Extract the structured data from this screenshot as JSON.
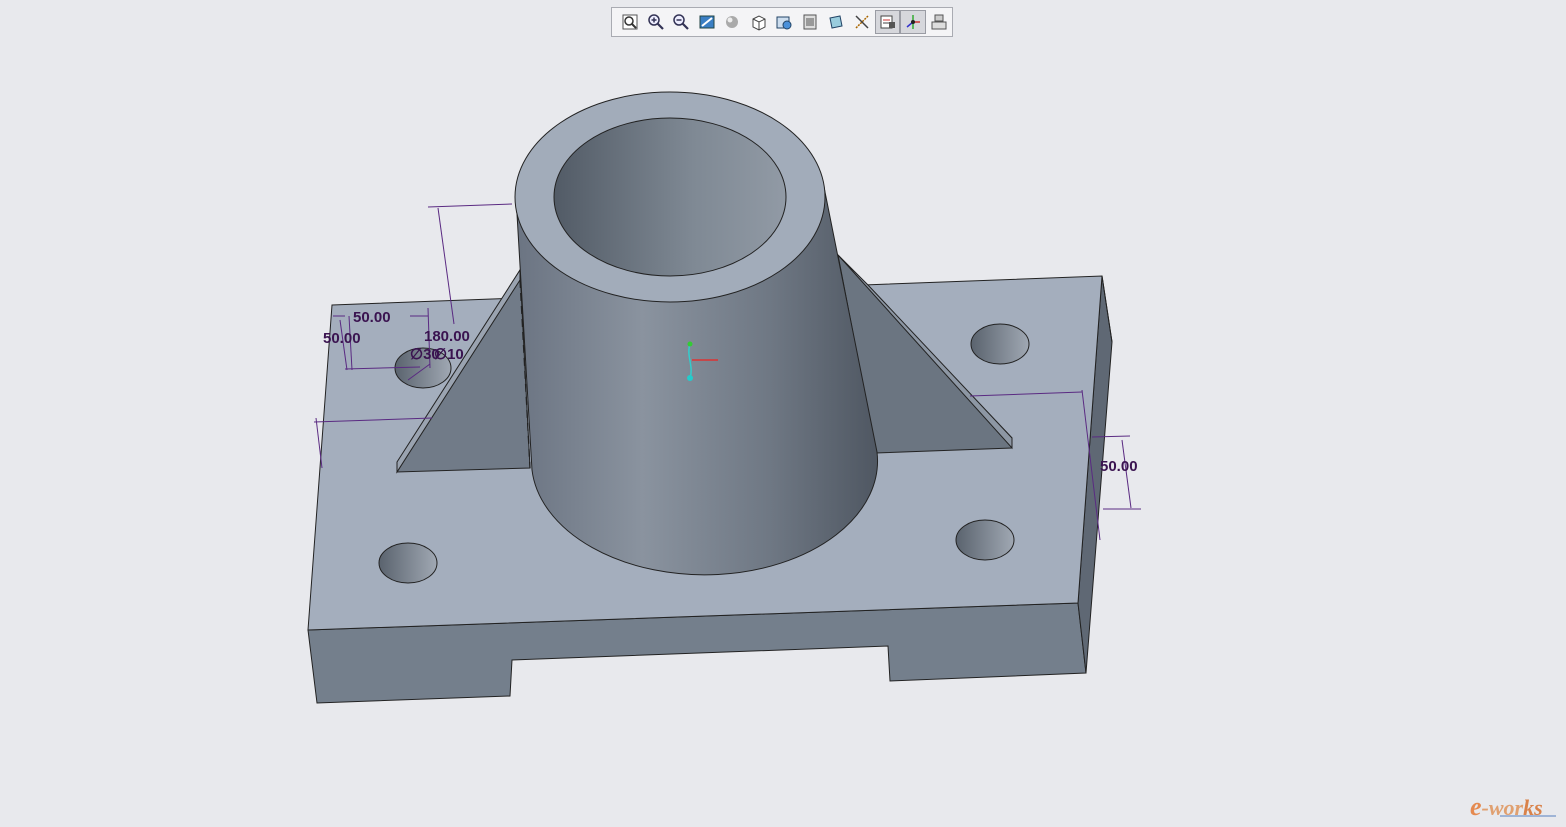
{
  "toolbar": {
    "buttons": [
      {
        "icon": "refit-icon",
        "label": "Refit"
      },
      {
        "icon": "zoom-in-icon",
        "label": "Zoom In"
      },
      {
        "icon": "zoom-out-icon",
        "label": "Zoom Out"
      },
      {
        "icon": "repaint-icon",
        "label": "Repaint"
      },
      {
        "icon": "display-style-icon",
        "label": "Display Style"
      },
      {
        "icon": "saved-views-icon",
        "label": "Saved Orientations"
      },
      {
        "icon": "view-manager-icon",
        "label": "View Manager"
      },
      {
        "icon": "section-icon",
        "label": "Section"
      },
      {
        "icon": "perspective-icon",
        "label": "Perspective"
      },
      {
        "icon": "datum-display-icon",
        "label": "Datum Display"
      },
      {
        "icon": "annotation-display-icon",
        "label": "Annotation Display",
        "active": true
      },
      {
        "icon": "spin-center-icon",
        "label": "Spin Center",
        "active": true
      },
      {
        "icon": "appearance-icon",
        "label": "Appearance"
      }
    ]
  },
  "dimensions": {
    "top_left_horizontal": "50.00",
    "top_left_vertical": "50.00",
    "height": "180.00",
    "hole_diameter": "∅30",
    "overlap_diameter": "∅10",
    "right_side": "50.00"
  },
  "colors": {
    "background": "#e8e9ed",
    "part_top": "#a4aebd",
    "part_side": "#747f8c",
    "dimension": "#5a2a82"
  },
  "watermark": {
    "brand_e": "e",
    "brand_rest": "-wor",
    "brand_end": "ks"
  }
}
